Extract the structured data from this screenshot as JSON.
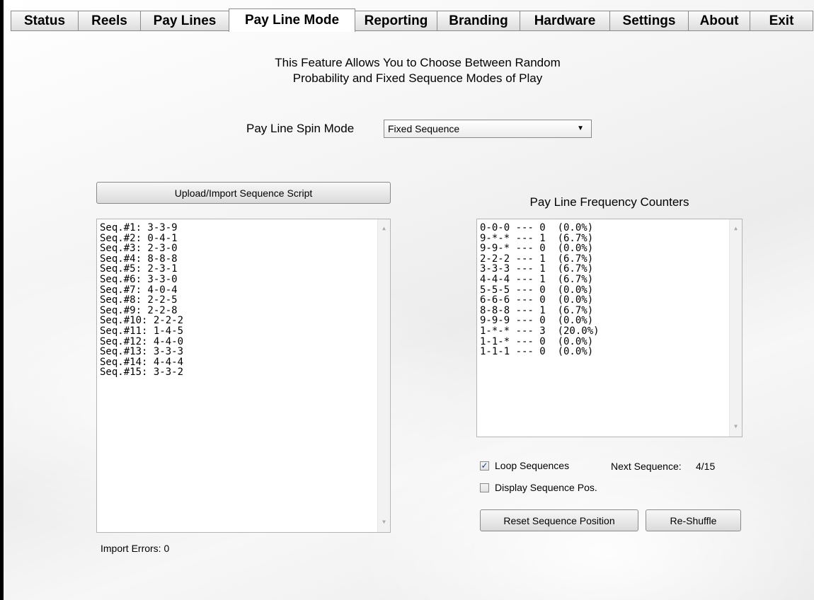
{
  "tabs": [
    {
      "label": "Status"
    },
    {
      "label": "Reels"
    },
    {
      "label": "Pay Lines"
    },
    {
      "label": "Pay Line Mode"
    },
    {
      "label": "Reporting"
    },
    {
      "label": "Branding"
    },
    {
      "label": "Hardware"
    },
    {
      "label": "Settings"
    },
    {
      "label": "About"
    },
    {
      "label": "Exit"
    }
  ],
  "active_tab": "Pay Line Mode",
  "intro": {
    "line1": "This Feature Allows You to Choose Between Random",
    "line2": "Probability and Fixed Sequence Modes of Play"
  },
  "spin_mode": {
    "label": "Pay Line Spin Mode",
    "selected": "Fixed Sequence"
  },
  "upload_button": "Upload/Import Sequence Script",
  "sequences": [
    "Seq.#1: 3-3-9",
    "Seq.#2: 0-4-1",
    "Seq.#3: 2-3-0",
    "Seq.#4: 8-8-8",
    "Seq.#5: 2-3-1",
    "Seq.#6: 3-3-0",
    "Seq.#7: 4-0-4",
    "Seq.#8: 2-2-5",
    "Seq.#9: 2-2-8",
    "Seq.#10: 2-2-2",
    "Seq.#11: 1-4-5",
    "Seq.#12: 4-4-0",
    "Seq.#13: 3-3-3",
    "Seq.#14: 4-4-4",
    "Seq.#15: 3-3-2"
  ],
  "import_errors": "Import Errors: 0",
  "frequency": {
    "title": "Pay Line Frequency Counters",
    "counters": [
      "0-0-0 --- 0  (0.0%)",
      "9-*-* --- 1  (6.7%)",
      "9-9-* --- 0  (0.0%)",
      "2-2-2 --- 1  (6.7%)",
      "3-3-3 --- 1  (6.7%)",
      "4-4-4 --- 1  (6.7%)",
      "5-5-5 --- 0  (0.0%)",
      "6-6-6 --- 0  (0.0%)",
      "8-8-8 --- 1  (6.7%)",
      "9-9-9 --- 0  (0.0%)",
      "1-*-* --- 3  (20.0%)",
      "1-1-* --- 0  (0.0%)",
      "1-1-1 --- 0  (0.0%)"
    ]
  },
  "loop_sequences": {
    "label": "Loop Sequences",
    "checked": true
  },
  "next_sequence": {
    "label": "Next Sequence:",
    "value": "4/15"
  },
  "display_sequence_pos": {
    "label": "Display Sequence Pos.",
    "checked": false
  },
  "reset_button": "Reset Sequence Position",
  "reshuffle_button": "Re-Shuffle"
}
